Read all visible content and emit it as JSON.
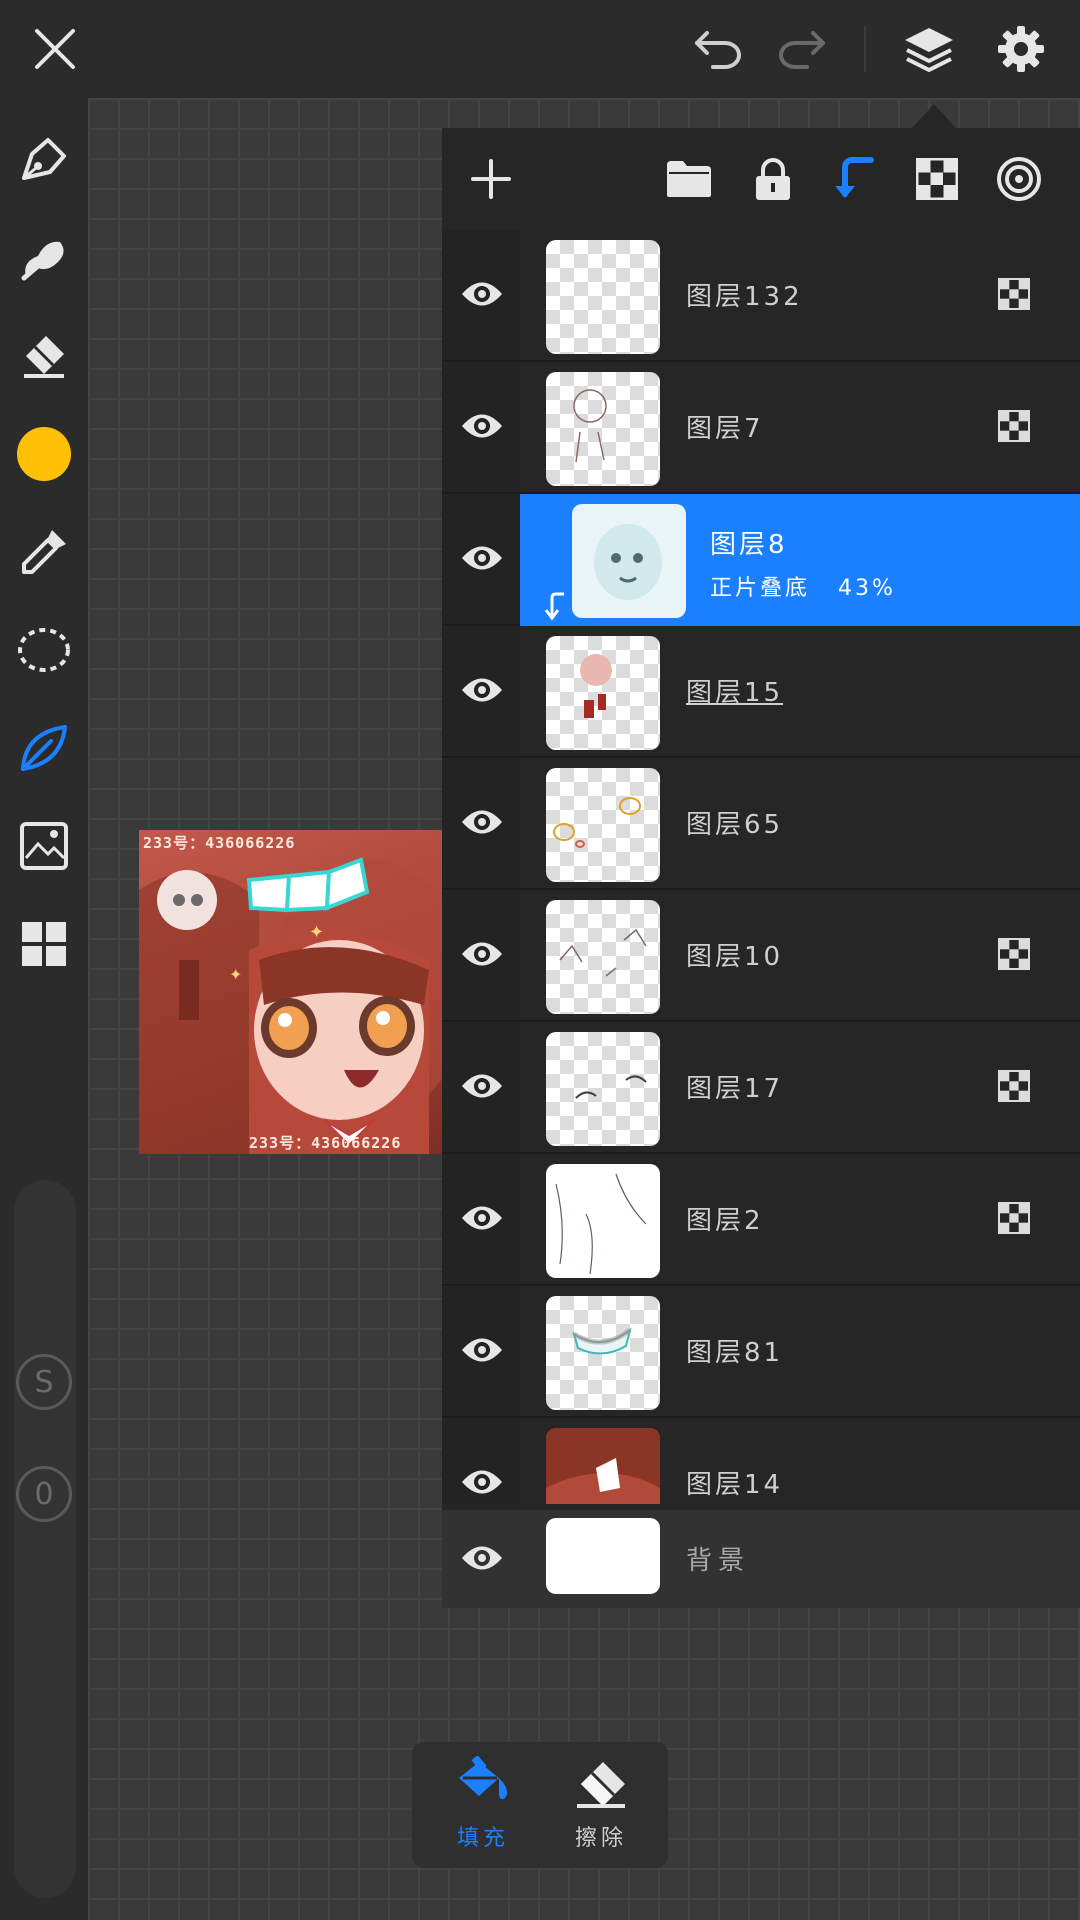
{
  "colors": {
    "accent": "#1a80ff",
    "current_color": "#ffc107",
    "panel_bg": "#262626",
    "toolbar_bg": "#2b2b2b"
  },
  "topbar": {
    "icons": [
      "close-icon",
      "undo-icon",
      "redo-icon",
      "layers-icon",
      "settings-icon"
    ]
  },
  "tools": [
    "pen-icon",
    "smudge-icon",
    "eraser-icon",
    "color-swatch",
    "eyedropper-icon",
    "lasso-icon",
    "leaf-brush-icon",
    "image-import-icon",
    "gallery-grid-icon"
  ],
  "sliders": {
    "size_label": "S",
    "opacity_label": "0"
  },
  "artwork": {
    "top_text": "233号：436066226",
    "bottom_text": "233号：436066226"
  },
  "layers_panel": {
    "header_icons": [
      "add-layer-icon",
      "folder-icon",
      "lock-icon",
      "clip-icon",
      "alpha-lock-icon",
      "reference-icon"
    ],
    "layers": [
      {
        "name": "图层132",
        "alpha_locked": true,
        "selected": false
      },
      {
        "name": "图层7",
        "alpha_locked": true,
        "selected": false
      },
      {
        "name": "图层8",
        "blend": "正片叠底",
        "opacity": "43%",
        "alpha_locked": false,
        "selected": true,
        "clipped": true
      },
      {
        "name": "图层15",
        "alpha_locked": false,
        "selected": false
      },
      {
        "name": "图层65",
        "alpha_locked": false,
        "selected": false
      },
      {
        "name": "图层10",
        "alpha_locked": true,
        "selected": false
      },
      {
        "name": "图层17",
        "alpha_locked": true,
        "selected": false
      },
      {
        "name": "图层2",
        "alpha_locked": true,
        "selected": false
      },
      {
        "name": "图层81",
        "alpha_locked": false,
        "selected": false
      },
      {
        "name": "图层14",
        "alpha_locked": false,
        "selected": false
      }
    ],
    "background": {
      "name": "背景"
    }
  },
  "bottom_popup": {
    "fill_label": "填充",
    "erase_label": "擦除"
  }
}
